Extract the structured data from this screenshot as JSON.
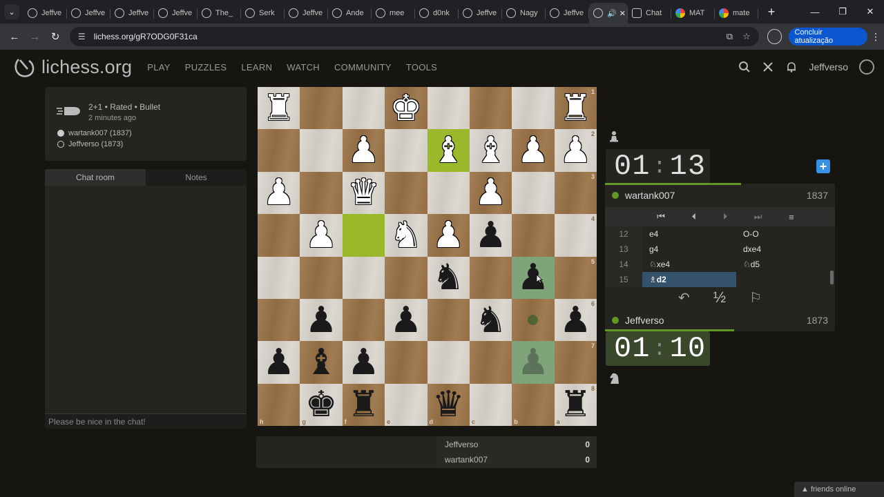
{
  "browser": {
    "tabs": [
      {
        "label": "Jeffve",
        "favicon": "lichess-icon"
      },
      {
        "label": "Jeffve",
        "favicon": "lichess-icon"
      },
      {
        "label": "Jeffve",
        "favicon": "lichess-icon"
      },
      {
        "label": "Jeffve",
        "favicon": "lichess-icon"
      },
      {
        "label": "The_",
        "favicon": "lichess-icon"
      },
      {
        "label": "Serk",
        "favicon": "lichess-icon"
      },
      {
        "label": "Jeffve",
        "favicon": "lichess-icon"
      },
      {
        "label": "Ande",
        "favicon": "lichess-icon"
      },
      {
        "label": "mee",
        "favicon": "lichess-icon"
      },
      {
        "label": "d0nk",
        "favicon": "lichess-icon"
      },
      {
        "label": "Jeffve",
        "favicon": "lichess-icon"
      },
      {
        "label": "Nagy",
        "favicon": "lichess-icon"
      },
      {
        "label": "Jeffve",
        "favicon": "lichess-icon"
      }
    ],
    "active_tab_audio": "🔊",
    "extra_tabs": [
      {
        "label": "Chat",
        "favicon": "chatgpt-icon"
      },
      {
        "label": "MAT",
        "favicon": "google-icon"
      },
      {
        "label": "mate",
        "favicon": "google-icon"
      }
    ],
    "url": "lichess.org/gR7ODG0F31ca",
    "update_label": "Concluir atualização"
  },
  "site": {
    "logo_text": "lichess.org",
    "nav": [
      "PLAY",
      "PUZZLES",
      "LEARN",
      "WATCH",
      "COMMUNITY",
      "TOOLS"
    ],
    "username": "Jeffverso"
  },
  "game": {
    "type": "2+1 • Rated • Bullet",
    "time_ago": "2 minutes ago",
    "white_player": "wartank007 (1837)",
    "black_player": "Jeffverso (1873)"
  },
  "chat": {
    "tabs": [
      "Chat room",
      "Notes"
    ],
    "placeholder": "Please be nice in the chat!"
  },
  "board": {
    "orientation": "black",
    "rank_labels": [
      "1",
      "2",
      "3",
      "4",
      "5",
      "6",
      "7",
      "8"
    ],
    "file_labels": [
      "h",
      "g",
      "f",
      "e",
      "d",
      "c",
      "b",
      "a"
    ],
    "rows": [
      [
        "wR",
        "",
        "",
        "wK",
        "",
        "",
        "",
        "wR"
      ],
      [
        "",
        "",
        "wP",
        "",
        "wB",
        "wB",
        "wP",
        "wP"
      ],
      [
        "wP",
        "",
        "wQ",
        "",
        "",
        "wP",
        "",
        ""
      ],
      [
        "",
        "wP",
        "",
        "wN",
        "wP",
        "bP",
        "",
        ""
      ],
      [
        "",
        "",
        "",
        "",
        "bN",
        "",
        "bP",
        ""
      ],
      [
        "",
        "bP",
        "",
        "bP",
        "",
        "bN",
        "",
        "bP"
      ],
      [
        "bP",
        "bB",
        "bP",
        "",
        "",
        "",
        "bPghost",
        ""
      ],
      [
        "",
        "bK",
        "bR",
        "",
        "bQ",
        "",
        "",
        "bR"
      ]
    ],
    "highlights": {
      "lastmove": [
        "1-4",
        "3-2"
      ],
      "premove": [
        "4-6",
        "6-6"
      ],
      "dest": [
        "5-6"
      ]
    }
  },
  "crosstable": [
    {
      "name": "Jeffverso",
      "score": "0"
    },
    {
      "name": "wartank007",
      "score": "0"
    }
  ],
  "clocks": {
    "opponent": {
      "min": "01",
      "sec": "13"
    },
    "player": {
      "min": "01",
      "sec": "10"
    }
  },
  "players": {
    "top": {
      "name": "wartank007",
      "rating": "1837"
    },
    "bottom": {
      "name": "Jeffverso",
      "rating": "1873"
    }
  },
  "moves": [
    {
      "n": "12",
      "w": "e4",
      "b": "O-O"
    },
    {
      "n": "13",
      "w": "g4",
      "b": "dxe4"
    },
    {
      "n": "14",
      "w": "♘xe4",
      "b": "♘d5"
    },
    {
      "n": "15",
      "w": "♗d2",
      "b": ""
    }
  ],
  "controls": {
    "first": "⏮",
    "prev": "⏴",
    "next": "⏵",
    "last": "⏭",
    "menu": "≡"
  },
  "actions": {
    "takeback": "↶",
    "draw": "½",
    "resign": "⚐"
  },
  "friends": "friends online"
}
